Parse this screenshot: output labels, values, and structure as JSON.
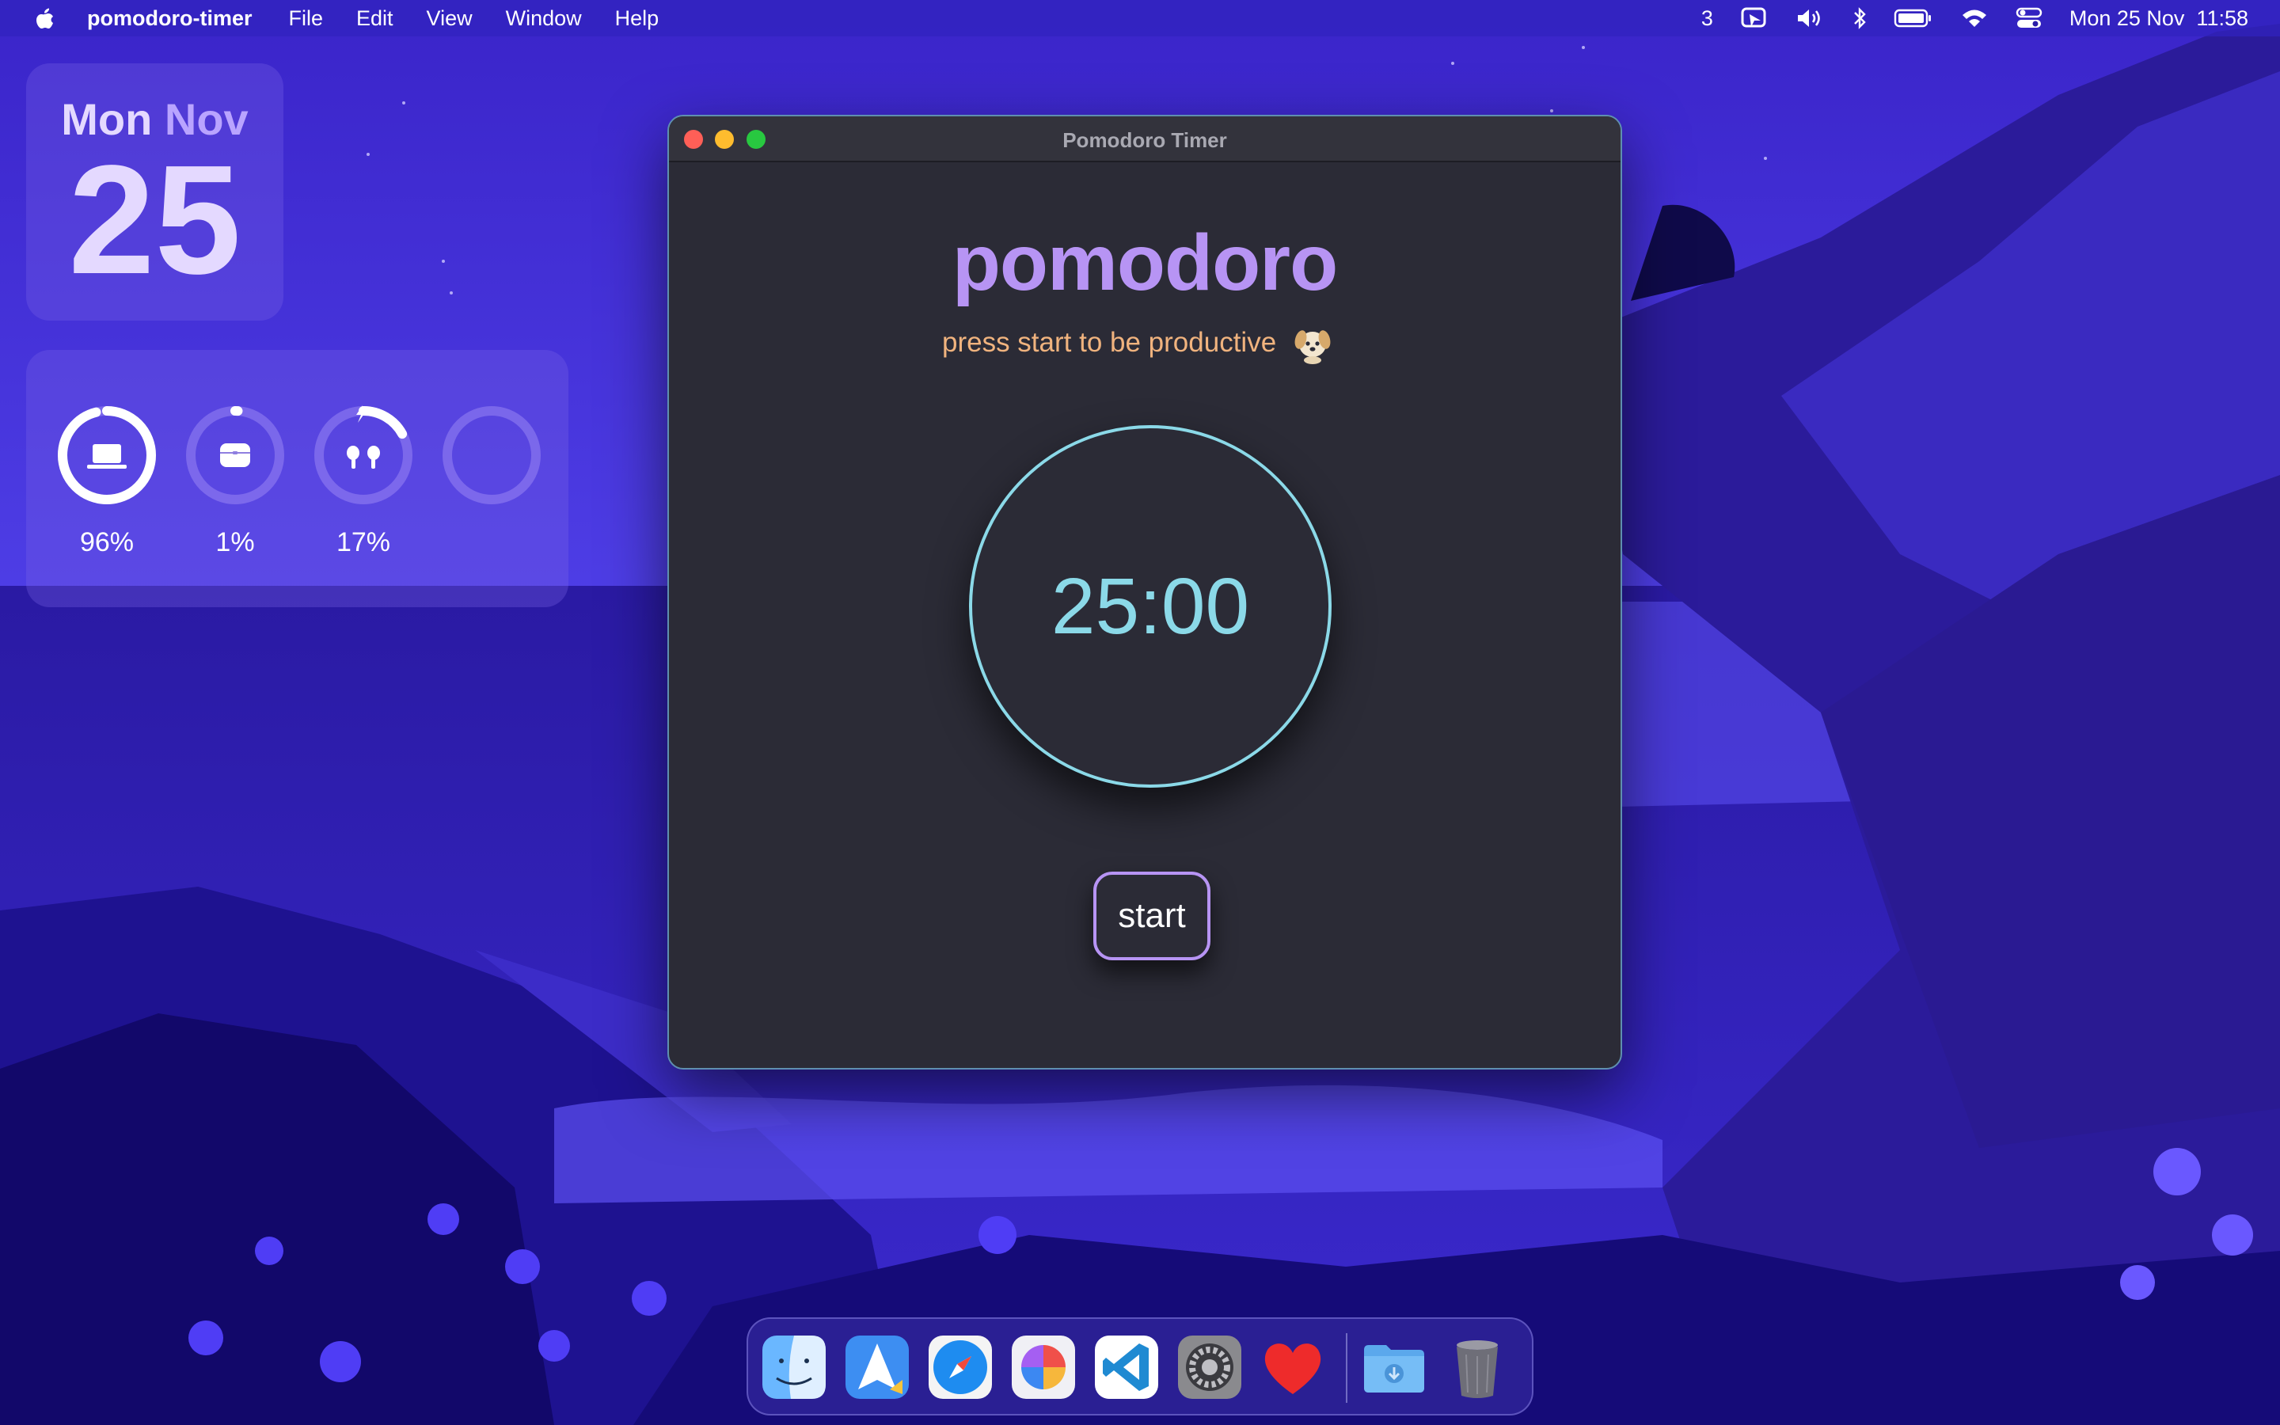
{
  "menubar": {
    "app_name": "pomodoro-timer",
    "menus": [
      "File",
      "Edit",
      "View",
      "Window",
      "Help"
    ],
    "status": {
      "badge_count": "3",
      "datetime": "Mon 25 Nov  11:58"
    }
  },
  "widgets": {
    "calendar": {
      "weekday": "Mon",
      "month": "Nov",
      "day": "25"
    },
    "batteries": [
      {
        "device": "laptop-icon",
        "level": "96%",
        "fraction": 0.96
      },
      {
        "device": "airpods-case-icon",
        "level": "1%",
        "fraction": 0.01
      },
      {
        "device": "airpods-icon",
        "level": "17%",
        "fraction": 0.17,
        "charging": true
      },
      {
        "device": "empty-slot",
        "level": "",
        "fraction": 0
      }
    ]
  },
  "window": {
    "title": "Pomodoro Timer",
    "brand": "pomodoro",
    "tagline": "press start to be productive",
    "timer": "25:00",
    "start_label": "start"
  },
  "dock": {
    "apps": [
      "finder-icon",
      "spark-mail-icon",
      "safari-icon",
      "pixelmator-icon",
      "vscode-icon",
      "system-settings-icon",
      "heart-icon",
      "downloads-folder-icon",
      "trash-icon"
    ]
  },
  "colors": {
    "accent_purple": "#b794f4",
    "timer_cyan": "#8bd9e8",
    "tagline_orange": "#f0b37e",
    "window_bg": "#2b2b36"
  }
}
